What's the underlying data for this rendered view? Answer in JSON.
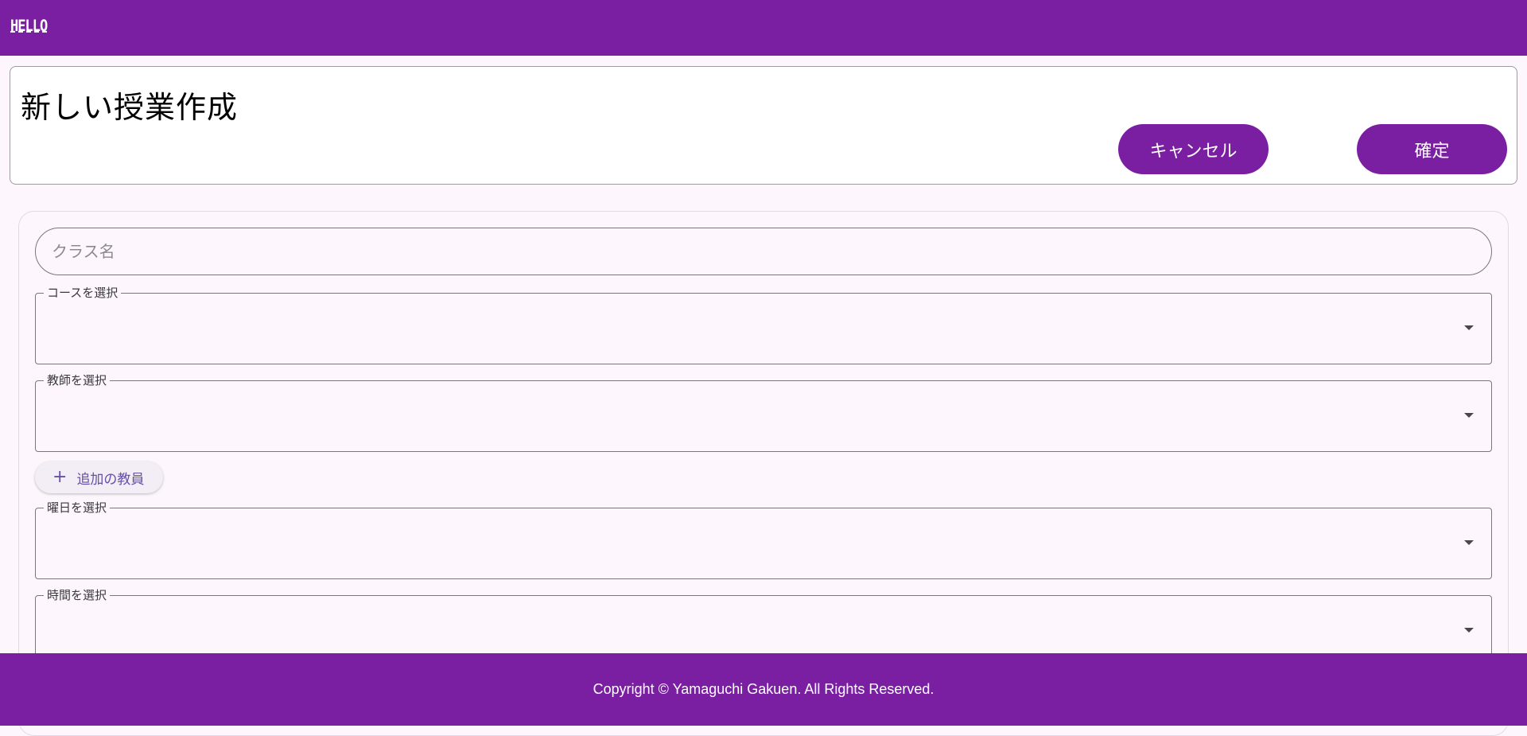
{
  "appbar": {
    "logo_text": "HELLO"
  },
  "header": {
    "title": "新しい授業作成",
    "cancel_label": "キャンセル",
    "confirm_label": "確定"
  },
  "form": {
    "class_name": {
      "placeholder": "クラス名",
      "value": ""
    },
    "course_select": {
      "label": "コースを選択",
      "value": ""
    },
    "teacher_select": {
      "label": "教師を選択",
      "value": ""
    },
    "add_teacher_label": "追加の教員",
    "day_select": {
      "label": "曜日を選択",
      "value": ""
    },
    "time_select": {
      "label": "時間を選択",
      "value": ""
    }
  },
  "footer": {
    "copyright": "Copyright © Yamaguchi Gakuen. All Rights Reserved."
  },
  "colors": {
    "primary": "#7b1fa2",
    "background": "#fdf7fd",
    "secondary_text": "#6750a4"
  },
  "icons": {
    "select_caret": "chevron-down-icon",
    "add": "plus-icon"
  }
}
